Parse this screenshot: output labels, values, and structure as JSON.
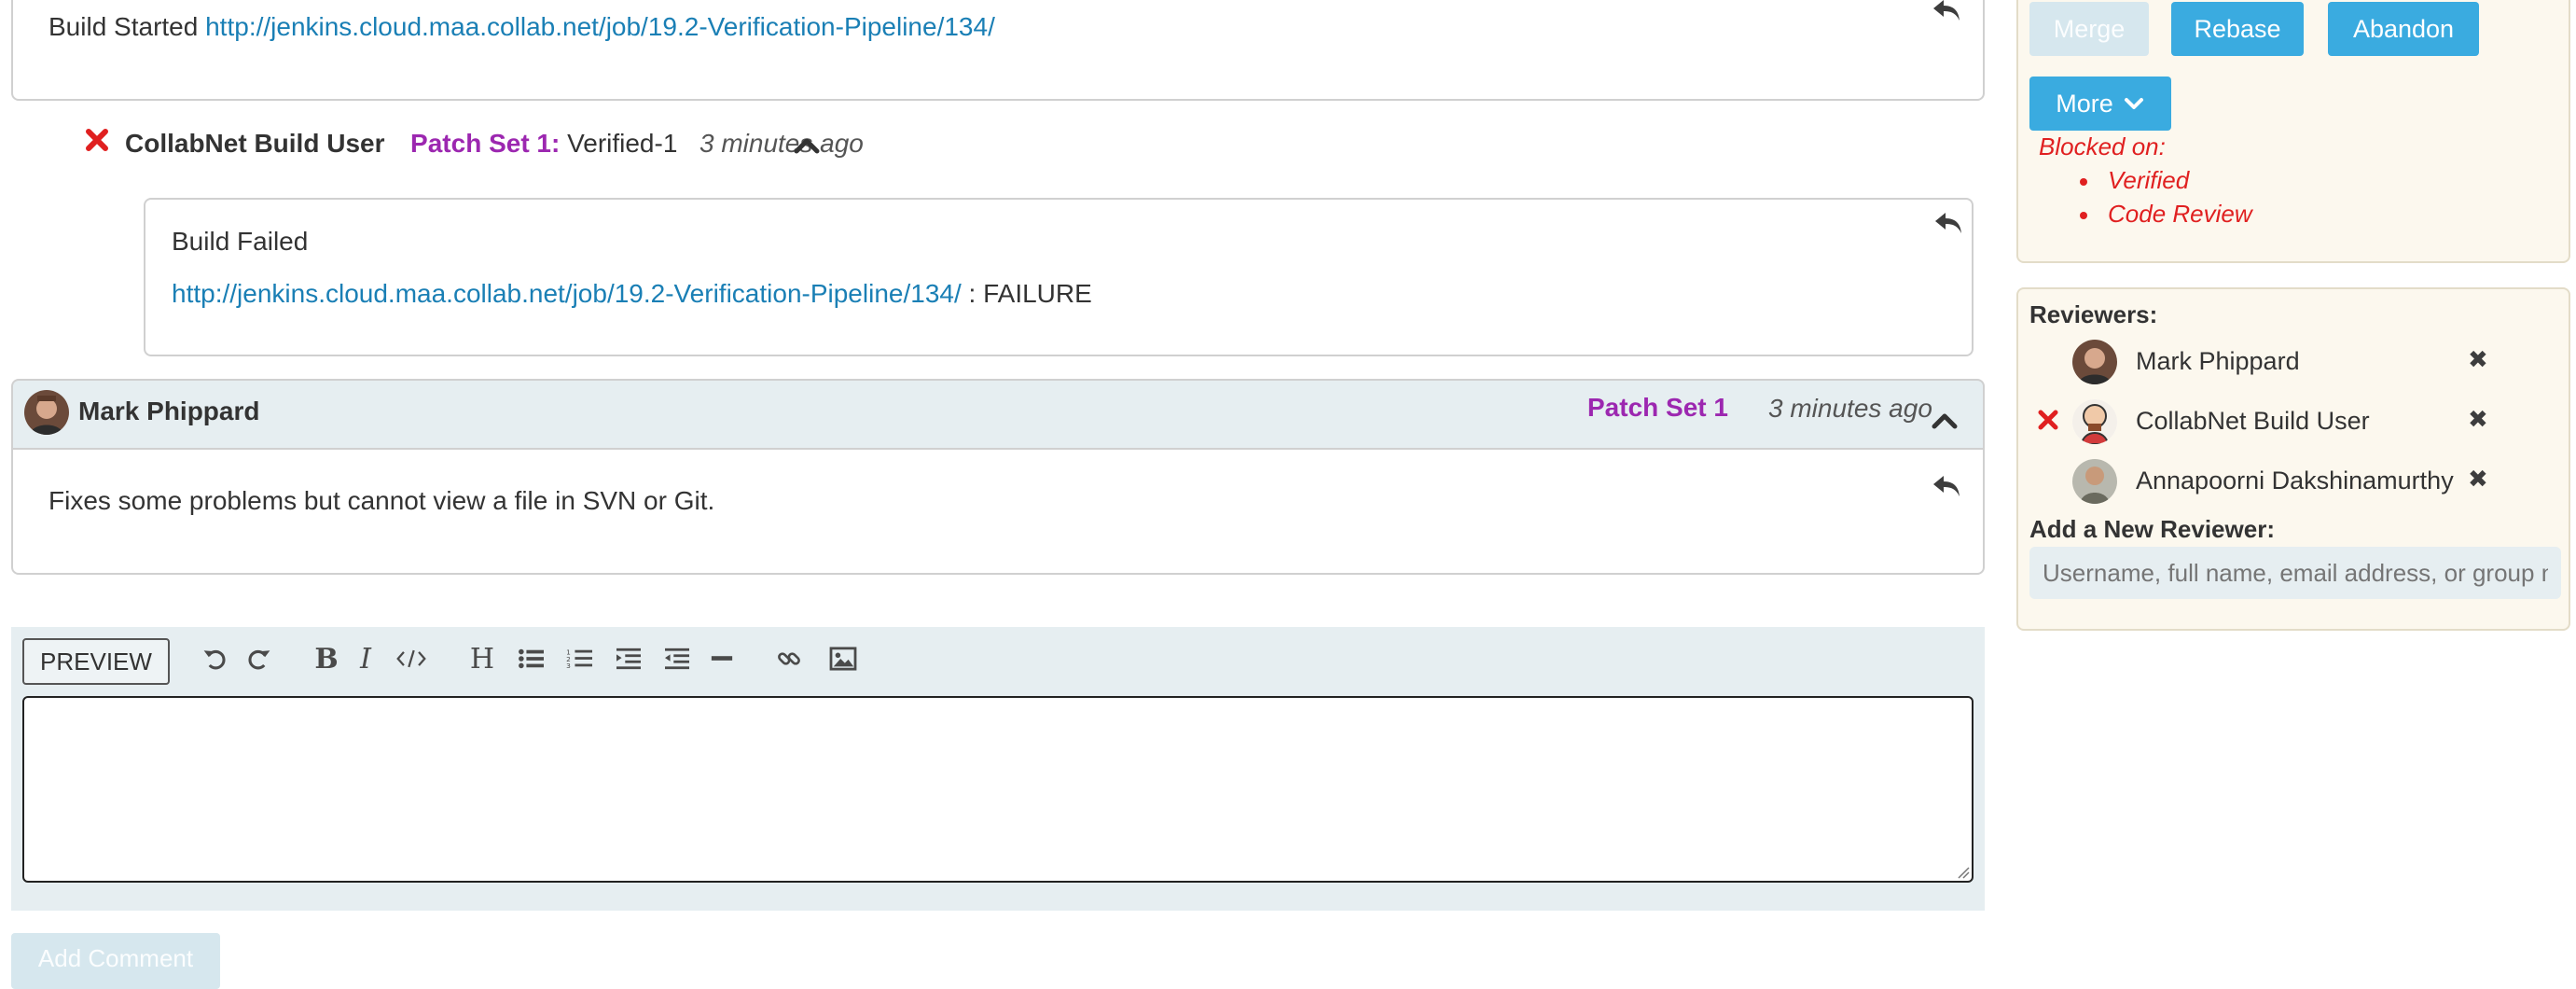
{
  "history": {
    "first": {
      "text_prefix": "Build Started",
      "link": "http://jenkins.cloud.maa.collab.net/job/19.2-Verification-Pipeline/134/"
    },
    "second": {
      "author": "CollabNet Build User",
      "patch": "Patch Set 1:",
      "vote": "Verified-1",
      "time": "3 minutes ago",
      "body_title": "Build Failed",
      "link": "http://jenkins.cloud.maa.collab.net/job/19.2-Verification-Pipeline/134/",
      "link_suffix": ": FAILURE"
    },
    "third": {
      "author": "Mark Phippard",
      "patch": "Patch Set 1",
      "time": "3 minutes ago",
      "body": "Fixes some problems but cannot view a file in SVN or Git."
    }
  },
  "editor": {
    "preview_label": "PREVIEW",
    "add_comment_label": "Add Comment"
  },
  "actions": {
    "merge": "Merge",
    "rebase": "Rebase",
    "abandon": "Abandon",
    "more": "More",
    "blocked_on_label": "Blocked on:",
    "blocked_items": [
      "Verified",
      "Code Review"
    ]
  },
  "reviewers": {
    "title": "Reviewers:",
    "list": [
      {
        "name": "Mark Phippard"
      },
      {
        "name": "CollabNet Build User"
      },
      {
        "name": "Annapoorni Dakshinamurthy"
      }
    ],
    "add_label": "Add a New Reviewer:",
    "add_placeholder": "Username, full name, email address, or group n"
  },
  "colors": {
    "link": "#1a7fb5",
    "patch_set": "#9c27b0",
    "button": "#3aabe0",
    "blocked": "#e02020"
  }
}
